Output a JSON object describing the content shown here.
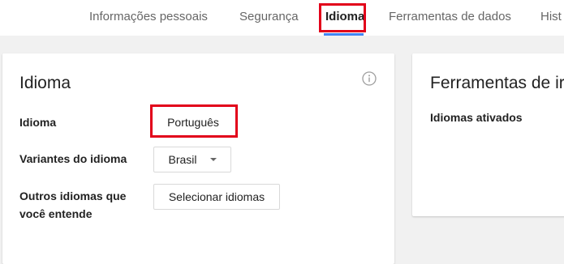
{
  "tabs": [
    {
      "label": "Informações pessoais"
    },
    {
      "label": "Segurança"
    },
    {
      "label": "Idioma"
    },
    {
      "label": "Ferramentas de dados"
    },
    {
      "label": "Hist"
    }
  ],
  "language_card": {
    "title": "Idioma",
    "info_icon": "info-icon",
    "rows": {
      "language_label": "Idioma",
      "language_value": "Português",
      "variants_label": "Variantes do idioma",
      "variants_value": "Brasil",
      "other_label_line1": "Outros idiomas que",
      "other_label_line2": "você entende",
      "other_button": "Selecionar idiomas"
    }
  },
  "tools_card": {
    "title": "Ferramentas de ir",
    "subtitle": "Idiomas ativados"
  },
  "colors": {
    "accent": "#4285f4",
    "highlight": "#e2001a",
    "background": "#f1f1f1"
  }
}
